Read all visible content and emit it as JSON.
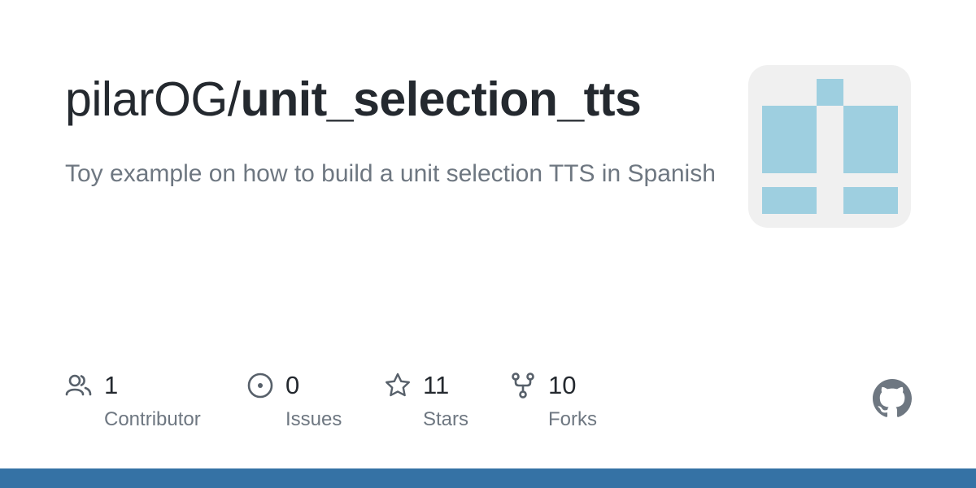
{
  "repo": {
    "owner": "pilarOG/",
    "name": "unit_selection_tts",
    "description": "Toy example on how to build a unit selection TTS in Spanish"
  },
  "stats": {
    "contributors": {
      "value": "1",
      "label": "Contributor",
      "icon": "people-icon"
    },
    "issues": {
      "value": "0",
      "label": "Issues",
      "icon": "issue-opened-icon"
    },
    "stars": {
      "value": "11",
      "label": "Stars",
      "icon": "star-icon"
    },
    "forks": {
      "value": "10",
      "label": "Forks",
      "icon": "repo-forked-icon"
    }
  },
  "colors": {
    "title": "#24292f",
    "muted": "#6e7781",
    "icon": "#57606a",
    "avatar_bg": "#f0f0f0",
    "avatar_fg": "#9ecfe0",
    "footer_bar": "#3572a5"
  },
  "brand_icon": "github-mark-icon"
}
